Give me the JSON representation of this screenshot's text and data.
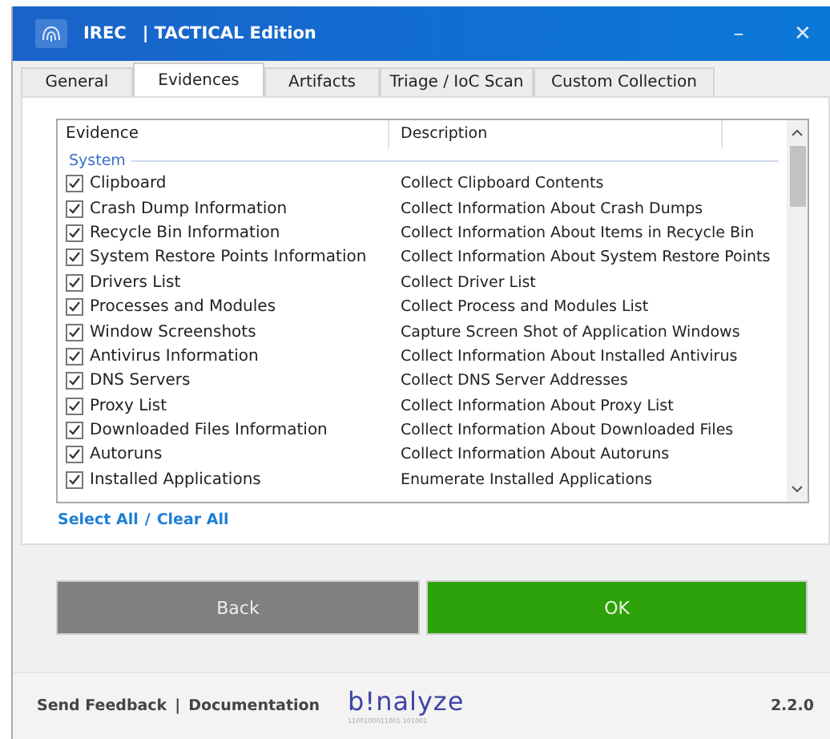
{
  "window": {
    "title": "IREC",
    "edition": "| TACTICAL Edition",
    "controls": [
      "–",
      "✕"
    ]
  },
  "tabs": [
    {
      "label": "General",
      "selected": false
    },
    {
      "label": "Evidences",
      "selected": true
    },
    {
      "label": "Artifacts",
      "selected": false
    },
    {
      "label": "Triage / IoC Scan",
      "selected": false
    },
    {
      "label": "Custom Collection",
      "selected": false
    }
  ],
  "table": {
    "columns": [
      "Evidence",
      "Description"
    ],
    "group": "System",
    "rows": [
      {
        "evidence": "Clipboard",
        "description": "Collect Clipboard Contents",
        "checked": true
      },
      {
        "evidence": "Crash Dump Information",
        "description": "Collect Information About Crash Dumps",
        "checked": true
      },
      {
        "evidence": "Recycle Bin Information",
        "description": "Collect Information About Items in Recycle Bin",
        "checked": true
      },
      {
        "evidence": "System Restore Points Information",
        "description": "Collect Information About System Restore Points",
        "checked": true
      },
      {
        "evidence": "Drivers List",
        "description": "Collect Driver List",
        "checked": true
      },
      {
        "evidence": "Processes and Modules",
        "description": "Collect Process and Modules List",
        "checked": true
      },
      {
        "evidence": "Window Screenshots",
        "description": "Capture Screen Shot of Application Windows",
        "checked": true
      },
      {
        "evidence": "Antivirus Information",
        "description": "Collect Information About Installed Antivirus",
        "checked": true
      },
      {
        "evidence": "DNS Servers",
        "description": "Collect DNS Server Addresses",
        "checked": true
      },
      {
        "evidence": "Proxy List",
        "description": "Collect Information About Proxy List",
        "checked": true
      },
      {
        "evidence": "Downloaded Files Information",
        "description": "Collect Information About Downloaded Files",
        "checked": true
      },
      {
        "evidence": "Autoruns",
        "description": "Collect Information About Autoruns",
        "checked": true
      },
      {
        "evidence": "Installed Applications",
        "description": "Enumerate Installed Applications",
        "checked": true
      }
    ]
  },
  "selection_links": [
    "Select All",
    "/",
    "Clear All"
  ],
  "buttons": [
    {
      "label": "Back",
      "kind": "secondary"
    },
    {
      "label": "OK",
      "kind": "primary"
    }
  ],
  "footer": {
    "links": [
      "Send Feedback",
      "|",
      "Documentation"
    ],
    "logo": "b!nalyze",
    "logo_sub": "1100100011001 101001",
    "version": "2.2.0"
  }
}
